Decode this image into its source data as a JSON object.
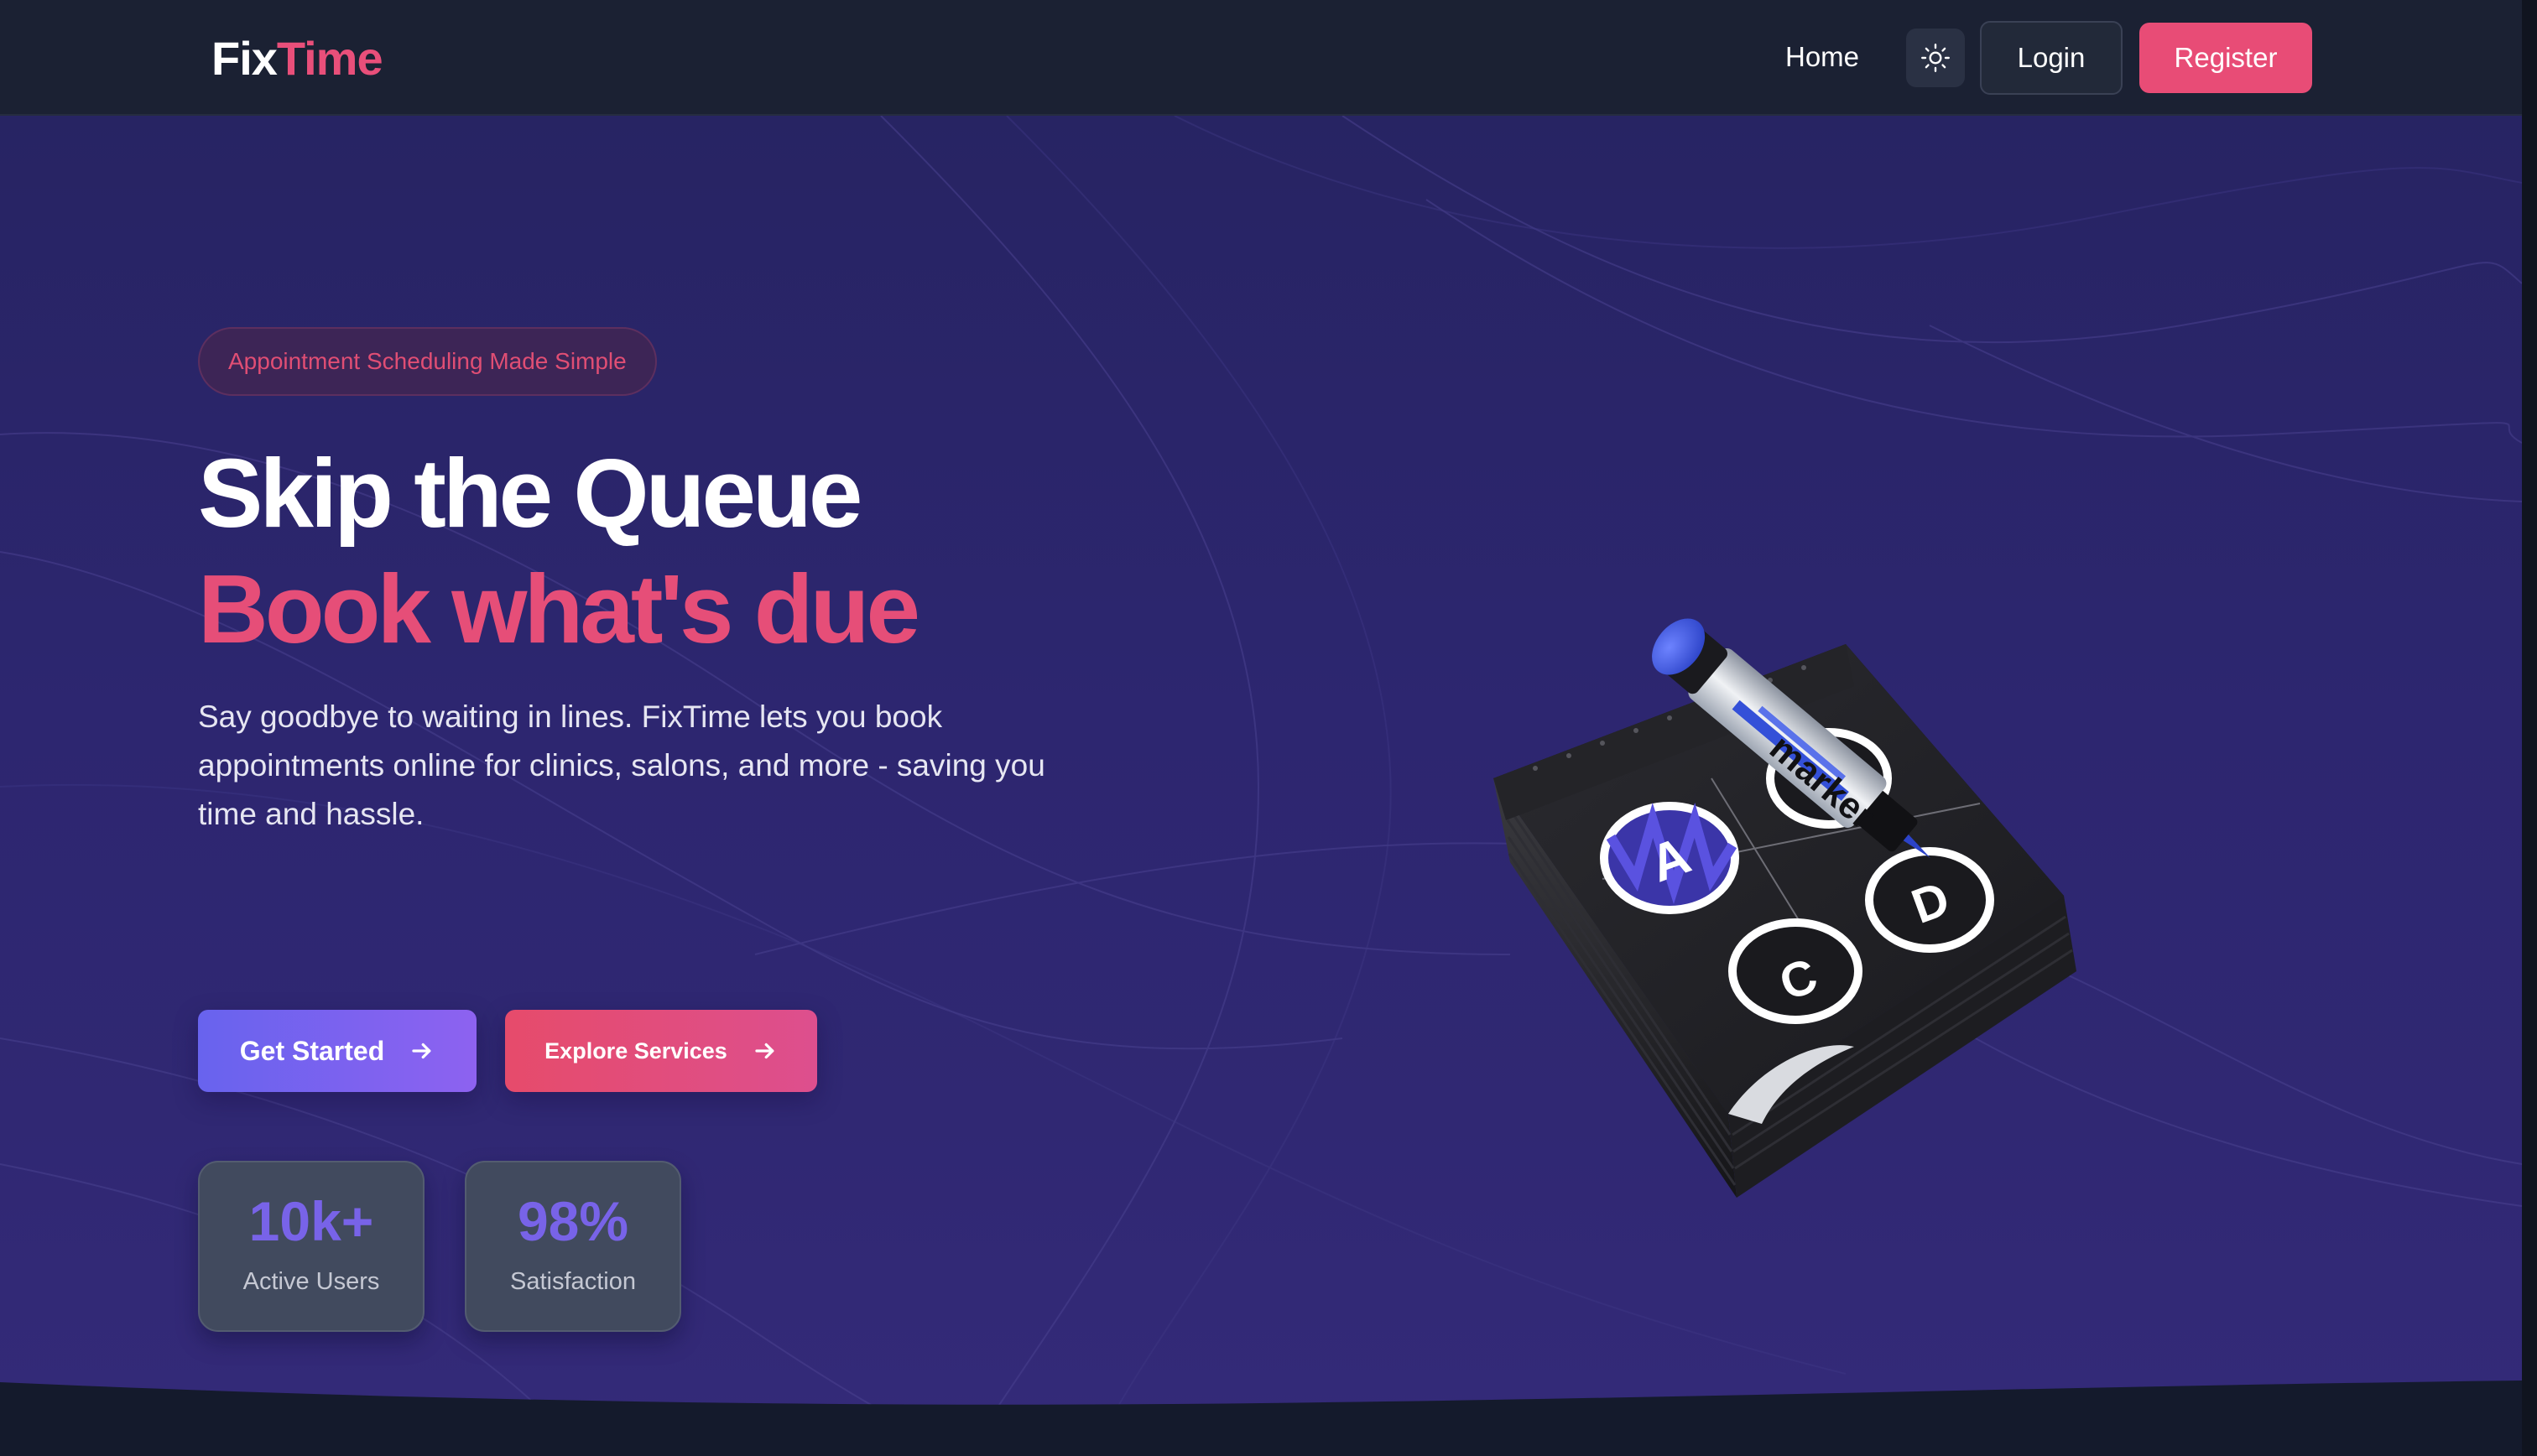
{
  "nav": {
    "logo_part1": "Fix",
    "logo_part2": "Time",
    "home": "Home",
    "theme_toggle_icon": "sun-icon",
    "login": "Login",
    "register": "Register"
  },
  "hero": {
    "tag": "Appointment Scheduling Made Simple",
    "headline_line1": "Skip the Queue",
    "headline_line2": "Book what's due",
    "description": "Say goodbye to waiting in lines. FixTime lets you book appointments online for clinics, salons, and more - saving you time and hassle.",
    "cta_primary": "Get Started",
    "cta_secondary": "Explore Services",
    "cta_icon": "arrow-right-icon",
    "illustration_text": "marker",
    "illustration_letters": [
      "A",
      "D",
      "C"
    ]
  },
  "stats": [
    {
      "value": "10k+",
      "label": "Active Users"
    },
    {
      "value": "98%",
      "label": "Satisfaction"
    }
  ],
  "colors": {
    "brand_pink": "#e84c76",
    "primary_purple": "#6f63ee",
    "hero_bg": "#2d2670",
    "nav_bg": "#1b2133",
    "page_bg": "#161b2e"
  }
}
